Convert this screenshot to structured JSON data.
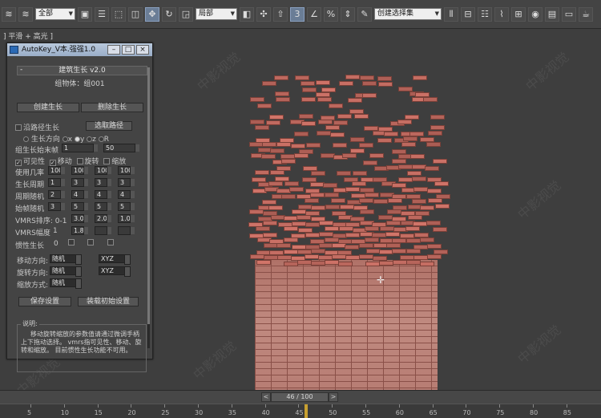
{
  "toolbar": {
    "selection_filter": "全部",
    "reference_coord": "局部",
    "named_selection": "创建选择集"
  },
  "viewport": {
    "label": "] 平滑 + 高光 ]",
    "watermark": "中影视觉"
  },
  "dialog": {
    "title": "AutoKey_V本.强强1.0",
    "rollout_title": "建筑生长 v2.0",
    "group_label": "组物体：组001",
    "create_button": "创建生长",
    "delete_button": "删除生长",
    "path_growth_label": "沿路径生长",
    "pick_path_button": "选取路径",
    "direction_label": "生长方向",
    "dir_x": "x",
    "dir_y": "y",
    "dir_z": "z",
    "dir_r": "R",
    "start_end_label": "组生长始末帧",
    "start_value": "1",
    "end_value": "50",
    "visibility_label": "可见性",
    "move_label": "移动",
    "rotate_label": "旋转",
    "scale_label": "缩放",
    "rows": [
      {
        "label": "使用几率",
        "values": [
          "100",
          "100",
          "100",
          "100"
        ]
      },
      {
        "label": "生长周期",
        "values": [
          "1",
          "3",
          "3",
          "3"
        ]
      },
      {
        "label": "周期随机",
        "values": [
          "2",
          "4",
          "4",
          "4"
        ]
      },
      {
        "label": "始帧随机",
        "values": [
          "3",
          "5",
          "5",
          "5"
        ]
      }
    ],
    "vmrs_order_label": "VMRS排序: 0-1",
    "vmrs_order_values": [
      "3.0",
      "2.0",
      "1.0"
    ],
    "vmrs_amp_label": "VMRS幅度",
    "vmrs_amp_value": "1",
    "vmrs_amp_values": [
      "1.8",
      "",
      ""
    ],
    "inertia_label": "惯性生长",
    "inertia_value": "0",
    "move_dir_label": "移动方向:",
    "move_dir_value": "随机",
    "move_axis_value": "XYZ",
    "rot_dir_label": "旋转方向:",
    "rot_dir_value": "随机",
    "rot_axis_value": "XYZ",
    "scale_mode_label": "缩放方式:",
    "scale_mode_value": "随机",
    "save_button": "保存设置",
    "load_button": "装载初始设置",
    "note_label": "说明:",
    "note_text": "移动旋转缩放的参数值请通过微调手柄上下拖动选择。 vmrs指可见性、移动、旋转和缩放。 目前惯性生长功能不可用。"
  },
  "timeline": {
    "current": "46 / 100",
    "prev": "<",
    "next": ">",
    "ticks": [
      "5",
      "10",
      "15",
      "20",
      "25",
      "30",
      "35",
      "40",
      "45",
      "50",
      "55",
      "60",
      "65",
      "70",
      "75",
      "80",
      "85"
    ]
  }
}
